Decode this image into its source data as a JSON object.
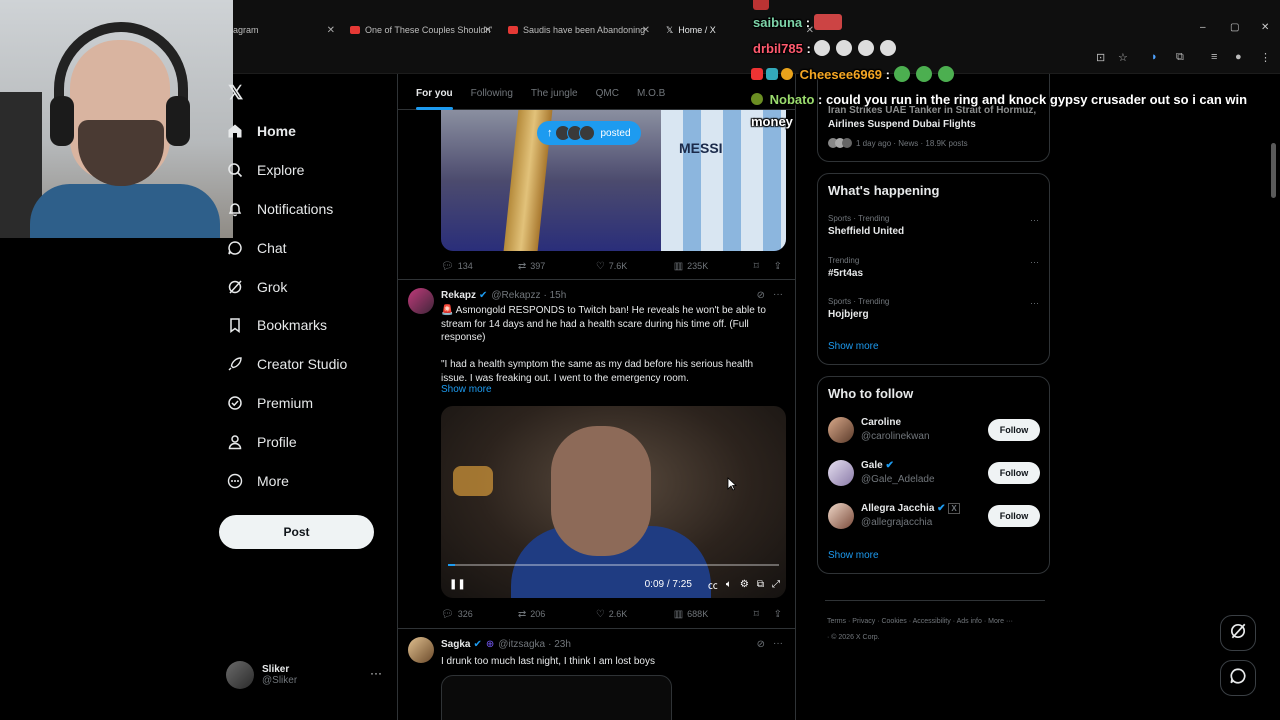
{
  "browser": {
    "tabs": [
      {
        "label": "agram",
        "active": false
      },
      {
        "label": "One of These Couples Shouldn't",
        "active": false
      },
      {
        "label": "Saudis have been Abandoning",
        "active": false
      },
      {
        "label": "Home / X",
        "active": true
      }
    ],
    "controls": {
      "minimize": "–",
      "maximize": "▢",
      "close": "✕"
    }
  },
  "nav": {
    "logo": "𝕏",
    "items": [
      {
        "label": "Home",
        "icon": "home-icon"
      },
      {
        "label": "Explore",
        "icon": "search-icon"
      },
      {
        "label": "Notifications",
        "icon": "bell-icon"
      },
      {
        "label": "Chat",
        "icon": "chat-icon"
      },
      {
        "label": "Grok",
        "icon": "grok-icon"
      },
      {
        "label": "Bookmarks",
        "icon": "bookmark-icon"
      },
      {
        "label": "Creator Studio",
        "icon": "rocket-icon"
      },
      {
        "label": "Premium",
        "icon": "premium-icon"
      },
      {
        "label": "Profile",
        "icon": "person-icon"
      },
      {
        "label": "More",
        "icon": "more-circle-icon"
      }
    ],
    "post_label": "Post",
    "account": {
      "name": "Sliker",
      "handle": "@Sliker",
      "more": "···"
    }
  },
  "timeline": {
    "tabs": [
      "For you",
      "Following",
      "The jungle",
      "QMC",
      "M.O.B"
    ],
    "posted_pill": {
      "label": "posted",
      "arrow": "↑"
    },
    "media_text": "MESSI",
    "tweet1_actions": {
      "replies": "134",
      "reposts": "397",
      "likes": "7.6K",
      "views": "235K"
    },
    "tweet2": {
      "name": "Rekapz",
      "handle": "@Rekapzz",
      "time": "· 15h",
      "text1": "🚨 Asmongold RESPONDS to Twitch ban! He reveals he won't be able to stream for 14 days and he had a health scare during his time off. (Full response)",
      "text2": "\"I had a health symptom the same as my dad before his serious health issue. I was freaking out. I went to the emergency room.",
      "show_more": "Show more",
      "video_time": "0:09 / 7:25",
      "video_progress": 0.02,
      "actions": {
        "replies": "326",
        "reposts": "206",
        "likes": "2.6K",
        "views": "688K"
      }
    },
    "tweet3": {
      "name": "Sagka",
      "handle": "@itzsagka",
      "time": "· 23h",
      "text": "I drunk too much last night, I think I am lost boys"
    }
  },
  "news_card": {
    "headline_line1": "Iran Strikes UAE Tanker in Strait of Hormuz,",
    "headline_line2": "Airlines Suspend Dubai Flights",
    "meta": "1 day ago · News · 18.9K posts"
  },
  "happening": {
    "title": "What's happening",
    "trends": [
      {
        "meta": "Sports · Trending",
        "name": "Sheffield United"
      },
      {
        "meta": "Trending",
        "name": "#5rt4as"
      },
      {
        "meta": "Sports · Trending",
        "name": "Hojbjerg"
      }
    ],
    "show_more": "Show more"
  },
  "who_to_follow": {
    "title": "Who to follow",
    "people": [
      {
        "name": "Caroline",
        "handle": "@carolinekwan",
        "verified": false
      },
      {
        "name": "Gale",
        "handle": "@Gale_Adelade",
        "verified": true
      },
      {
        "name": "Allegra Jacchia",
        "handle": "@allegrajacchia",
        "verified": true
      }
    ],
    "follow_label": "Follow",
    "show_more": "Show more"
  },
  "footer": {
    "links": [
      "Terms",
      "Privacy",
      "Cookies",
      "Accessibility",
      "Ads info",
      "More ···",
      "© 2026 X Corp."
    ]
  },
  "chat": [
    {
      "user": "saibuna",
      "text": ":",
      "color": "#7dd3a8"
    },
    {
      "user": "drbil785",
      "text": ":",
      "color": "#ff5a6e"
    },
    {
      "user": "Cheesee6969",
      "text": ":",
      "color": "#f5a623"
    },
    {
      "user": "Nobato",
      "text": ": could you run in the ring and knock gypsy crusader out so i can win",
      "color": "#9bdc6e"
    },
    {
      "user": "",
      "text": "money",
      "color": "#ffffff"
    }
  ],
  "colors": {
    "accent": "#1d9bf0",
    "bg": "#000000",
    "text": "#e7e9ea",
    "muted": "#71767b"
  }
}
